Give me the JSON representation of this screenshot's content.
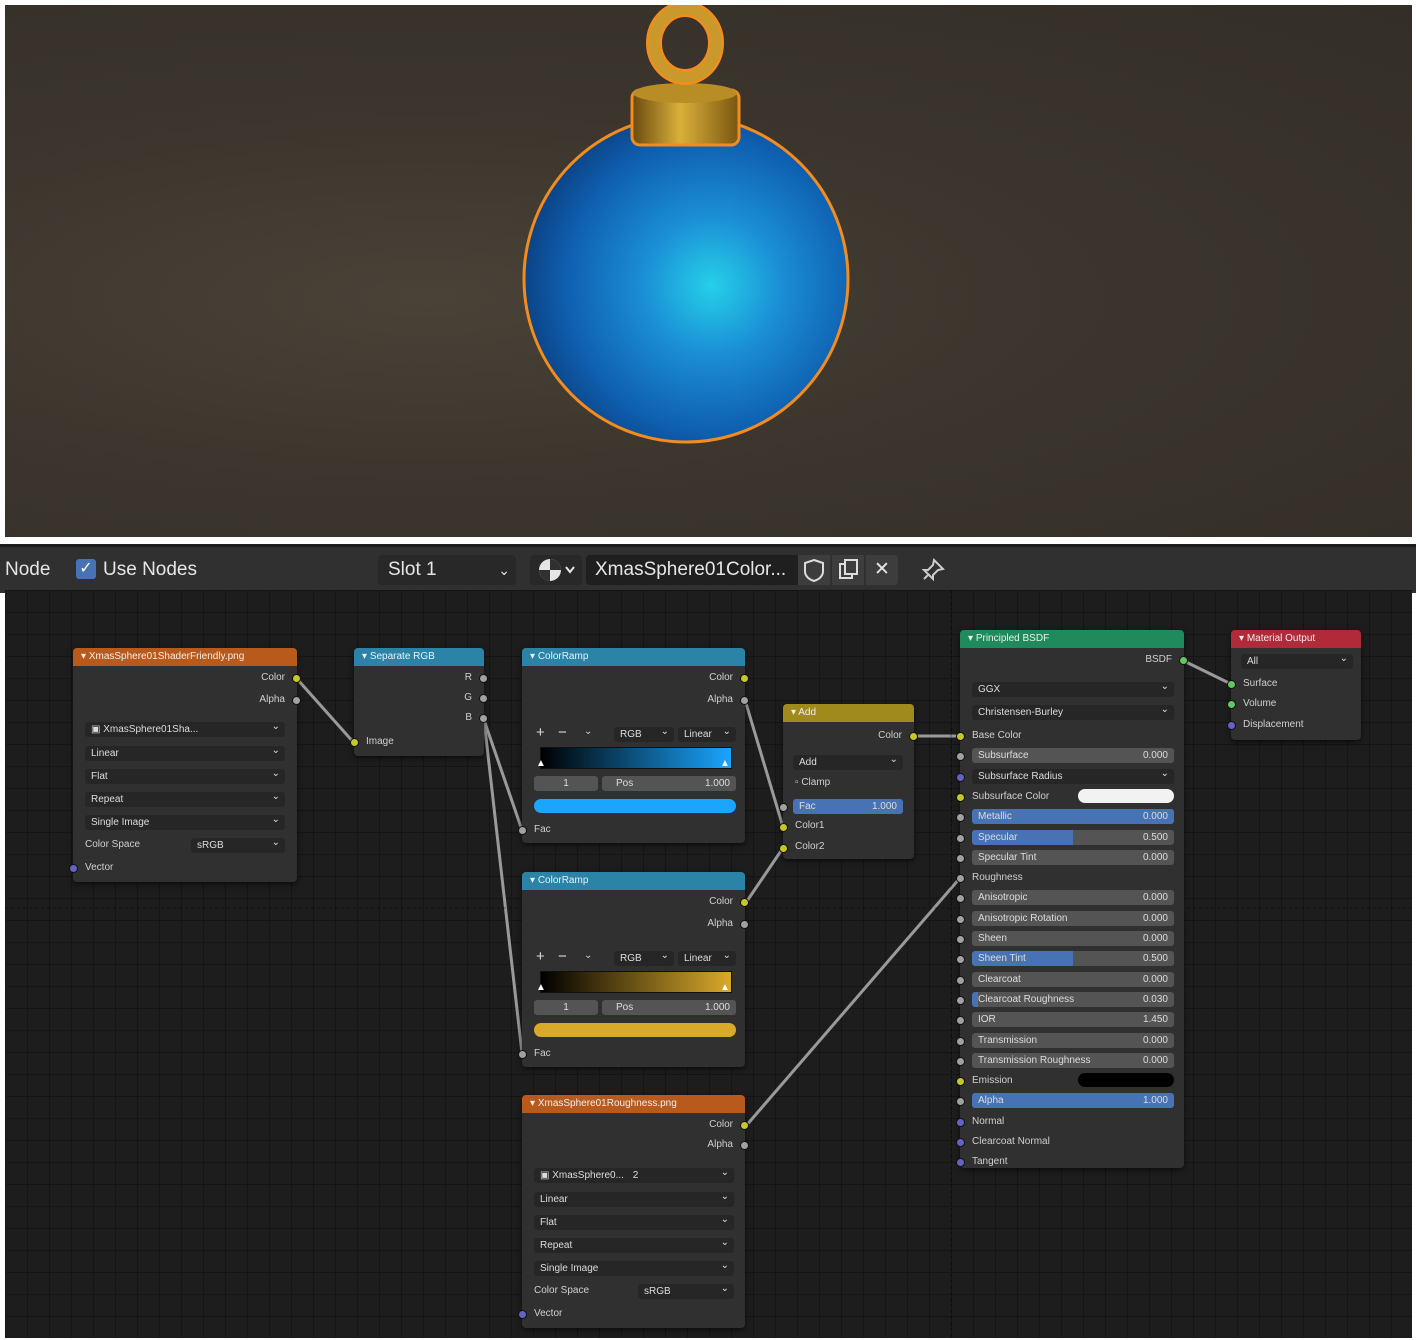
{
  "header": {
    "editor_label": "Node",
    "use_nodes_label": "Use Nodes",
    "use_nodes_checked": true,
    "slot": "Slot 1",
    "material_name": "XmasSphere01Color..."
  },
  "colors": {
    "image_node": "#b85a1c",
    "separate_node": "#2b84a8",
    "colorramp_node": "#2b84a8",
    "math_node": "#a08a1c",
    "bsdf_node": "#1f8a5c",
    "output_node": "#b02a3a",
    "ramp1_end": "#1aa5ff",
    "ramp2_end": "#d9a92a"
  },
  "nodes": {
    "image1": {
      "title": "XmasSphere01ShaderFriendly.png",
      "out_color": "Color",
      "out_alpha": "Alpha",
      "image_name": "XmasSphere01Sha...",
      "interpolation": "Linear",
      "projection": "Flat",
      "extension": "Repeat",
      "source": "Single Image",
      "colorspace_label": "Color Space",
      "colorspace": "sRGB",
      "in_vector": "Vector"
    },
    "separate": {
      "title": "Separate RGB",
      "out_r": "R",
      "out_g": "G",
      "out_b": "B",
      "in_image": "Image"
    },
    "ramp1": {
      "title": "ColorRamp",
      "out_color": "Color",
      "out_alpha": "Alpha",
      "mode": "RGB",
      "interp": "Linear",
      "plus": "+",
      "minus": "−",
      "index": "1",
      "pos_label": "Pos",
      "pos": "1.000",
      "in_fac": "Fac"
    },
    "ramp2": {
      "title": "ColorRamp",
      "out_color": "Color",
      "out_alpha": "Alpha",
      "mode": "RGB",
      "interp": "Linear",
      "plus": "+",
      "minus": "−",
      "index": "1",
      "pos_label": "Pos",
      "pos": "1.000",
      "in_fac": "Fac"
    },
    "add": {
      "title": "Add",
      "out_color": "Color",
      "blend": "Add",
      "clamp": "Clamp",
      "fac_label": "Fac",
      "fac": "1.000",
      "in_color1": "Color1",
      "in_color2": "Color2"
    },
    "image2": {
      "title": "XmasSphere01Roughness.png",
      "out_color": "Color",
      "out_alpha": "Alpha",
      "image_name": "XmasSphere0...",
      "users": "2",
      "interpolation": "Linear",
      "projection": "Flat",
      "extension": "Repeat",
      "source": "Single Image",
      "colorspace_label": "Color Space",
      "colorspace": "sRGB",
      "in_vector": "Vector"
    },
    "bsdf": {
      "title": "Principled BSDF",
      "out_bsdf": "BSDF",
      "distribution": "GGX",
      "subsurface_method": "Christensen-Burley",
      "inputs": [
        {
          "label": "Base Color"
        },
        {
          "label": "Subsurface",
          "value": "0.000"
        },
        {
          "label": "Subsurface Radius"
        },
        {
          "label": "Subsurface Color"
        },
        {
          "label": "Metallic",
          "value": "0.000",
          "fill": 1.0
        },
        {
          "label": "Specular",
          "value": "0.500",
          "fill": 0.5
        },
        {
          "label": "Specular Tint",
          "value": "0.000"
        },
        {
          "label": "Roughness"
        },
        {
          "label": "Anisotropic",
          "value": "0.000"
        },
        {
          "label": "Anisotropic Rotation",
          "value": "0.000"
        },
        {
          "label": "Sheen",
          "value": "0.000"
        },
        {
          "label": "Sheen Tint",
          "value": "0.500",
          "fill": 0.5
        },
        {
          "label": "Clearcoat",
          "value": "0.000"
        },
        {
          "label": "Clearcoat Roughness",
          "value": "0.030",
          "fill": 0.03
        },
        {
          "label": "IOR",
          "value": "1.450"
        },
        {
          "label": "Transmission",
          "value": "0.000"
        },
        {
          "label": "Transmission Roughness",
          "value": "0.000"
        },
        {
          "label": "Emission"
        },
        {
          "label": "Alpha",
          "value": "1.000",
          "fill": 1.0
        },
        {
          "label": "Normal"
        },
        {
          "label": "Clearcoat Normal"
        },
        {
          "label": "Tangent"
        }
      ]
    },
    "output": {
      "title": "Material Output",
      "target": "All",
      "in_surface": "Surface",
      "in_volume": "Volume",
      "in_displacement": "Displacement"
    }
  }
}
